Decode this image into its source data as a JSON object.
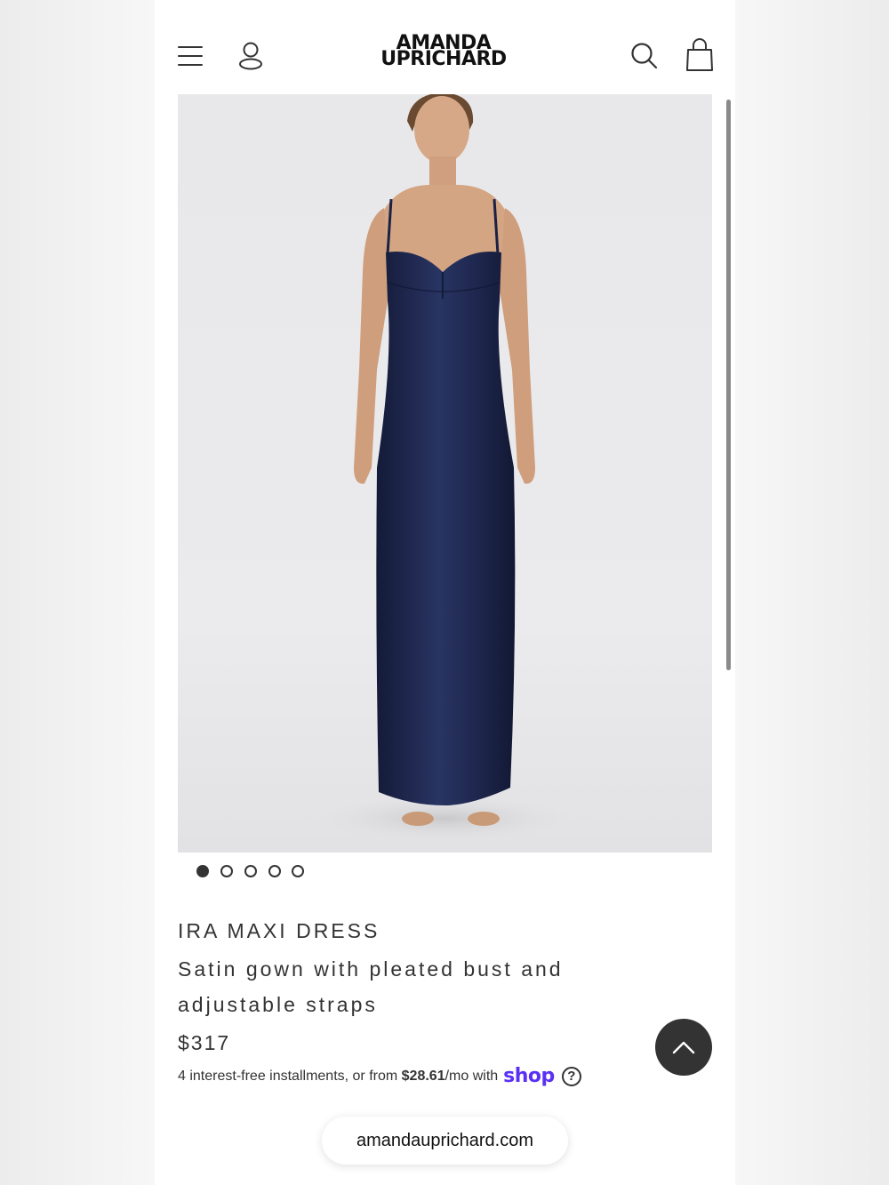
{
  "brand": {
    "logo_line1": "AMANDA",
    "logo_line2": "UPRICHARD"
  },
  "header": {
    "icons": [
      "hamburger-menu-icon",
      "account-icon",
      "search-icon",
      "shopping-bag-icon"
    ]
  },
  "gallery": {
    "total_images": 5,
    "active_index": 0
  },
  "product": {
    "name": "IRA MAXI DRESS",
    "description": "Satin gown with pleated bust and adjustable straps",
    "price": "$317",
    "installments_text": "4 interest-free installments, or from",
    "installment_amount": "$28.61",
    "installment_suffix": "/mo with",
    "payment_brand": "shop"
  },
  "browser": {
    "url": "amandauprichard.com"
  },
  "colors": {
    "dress": "#1c2448",
    "shop_brand": "#5a31f4",
    "button_dark": "#333333"
  }
}
